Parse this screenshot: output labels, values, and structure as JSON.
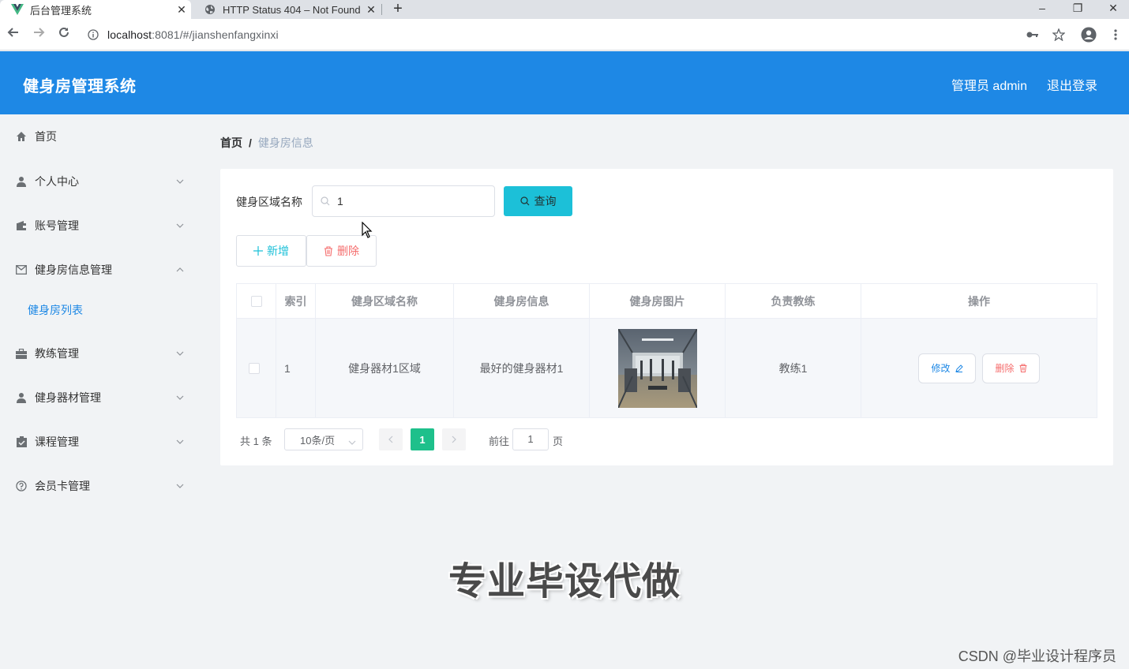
{
  "browser": {
    "tabs": [
      {
        "title": "后台管理系统",
        "active": true,
        "icon": "vue-logo-icon"
      },
      {
        "title": "HTTP Status 404 – Not Found",
        "active": false,
        "icon": "globe-icon"
      }
    ],
    "new_tab": "+",
    "url_host": "localhost",
    "url_path": ":8081/#/jianshenfangxinxi",
    "window_controls": {
      "minimize": "–",
      "restore": "❐",
      "close": "✕"
    }
  },
  "header": {
    "title": "健身房管理系统",
    "user": "管理员 admin",
    "logout": "退出登录",
    "color": "#1e88e5"
  },
  "sidebar": {
    "items": [
      {
        "label": "首页",
        "icon": "home-icon",
        "expandable": false
      },
      {
        "label": "个人中心",
        "icon": "user-icon",
        "expandable": true,
        "expanded": false
      },
      {
        "label": "账号管理",
        "icon": "wallet-icon",
        "expandable": true,
        "expanded": false
      },
      {
        "label": "健身房信息管理",
        "icon": "mail-icon",
        "expandable": true,
        "expanded": true
      },
      {
        "label": "教练管理",
        "icon": "briefcase-icon",
        "expandable": true,
        "expanded": false
      },
      {
        "label": "健身器材管理",
        "icon": "user-icon",
        "expandable": true,
        "expanded": false
      },
      {
        "label": "课程管理",
        "icon": "checklist-icon",
        "expandable": true,
        "expanded": false
      },
      {
        "label": "会员卡管理",
        "icon": "help-circle-icon",
        "expandable": true,
        "expanded": false
      }
    ],
    "sub_item": "健身房列表"
  },
  "breadcrumb": {
    "home": "首页",
    "separator": "/",
    "current": "健身房信息"
  },
  "search": {
    "label": "健身区域名称",
    "value": "1",
    "query_button": "查询"
  },
  "actions": {
    "add": "新增",
    "delete": "删除"
  },
  "table": {
    "columns": [
      "索引",
      "健身区域名称",
      "健身房信息",
      "健身房图片",
      "负责教练",
      "操作"
    ],
    "rows": [
      {
        "index": "1",
        "area": "健身器材1区域",
        "info": "最好的健身器材1",
        "coach": "教练1",
        "edit": "修改",
        "delete": "删除"
      }
    ]
  },
  "pagination": {
    "total": "共 1 条",
    "page_size": "10条/页",
    "current_page": "1",
    "goto_label": "前往",
    "goto_value": "1",
    "page_suffix": "页"
  },
  "watermark": "专业毕设代做",
  "footer_watermark": "CSDN @毕业设计程序员",
  "colors": {
    "accent": "#1e88e5",
    "query": "#1cc0d8",
    "danger": "#f56c6c",
    "page_active": "#1ec08b"
  }
}
